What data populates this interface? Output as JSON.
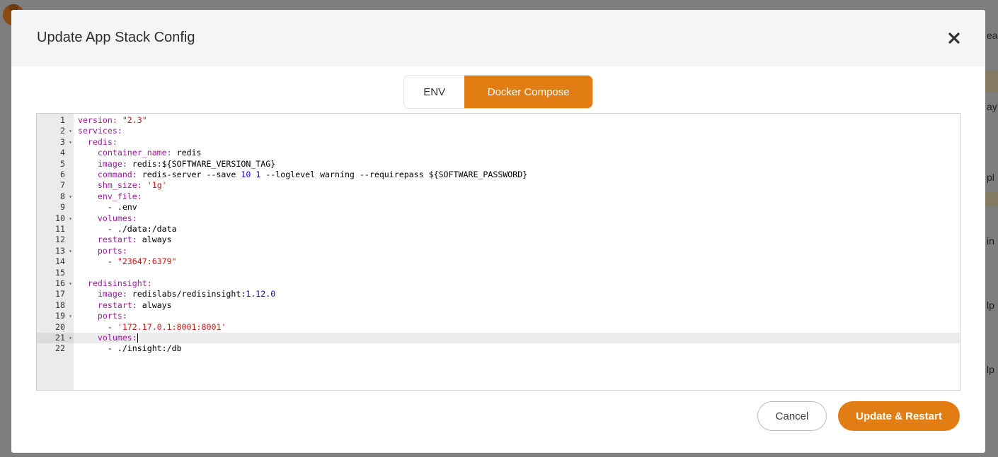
{
  "background": {
    "side_labels": [
      "ead",
      "ay",
      "pl",
      "in",
      "lp",
      "lp"
    ]
  },
  "modal": {
    "title": "Update App Stack Config",
    "close_icon": "close-icon",
    "tabs": [
      {
        "label": "ENV",
        "active": false
      },
      {
        "label": "Docker Compose",
        "active": true
      }
    ],
    "editor": {
      "active_line": 21,
      "lines": [
        {
          "n": "1",
          "fold": false,
          "tokens": [
            {
              "t": "key",
              "v": "version: "
            },
            {
              "t": "str",
              "v": "\"2.3\""
            }
          ]
        },
        {
          "n": "2",
          "fold": true,
          "tokens": [
            {
              "t": "key",
              "v": "services:"
            }
          ]
        },
        {
          "n": "3",
          "fold": true,
          "tokens": [
            {
              "t": "plain",
              "v": "  "
            },
            {
              "t": "key",
              "v": "redis:"
            }
          ]
        },
        {
          "n": "4",
          "fold": false,
          "tokens": [
            {
              "t": "plain",
              "v": "    "
            },
            {
              "t": "key",
              "v": "container_name: "
            },
            {
              "t": "plain",
              "v": "redis"
            }
          ]
        },
        {
          "n": "5",
          "fold": false,
          "tokens": [
            {
              "t": "plain",
              "v": "    "
            },
            {
              "t": "key",
              "v": "image: "
            },
            {
              "t": "plain",
              "v": "redis:${SOFTWARE_VERSION_TAG}"
            }
          ]
        },
        {
          "n": "6",
          "fold": false,
          "tokens": [
            {
              "t": "plain",
              "v": "    "
            },
            {
              "t": "key",
              "v": "command: "
            },
            {
              "t": "plain",
              "v": "redis-server --save "
            },
            {
              "t": "num",
              "v": "10"
            },
            {
              "t": "plain",
              "v": " "
            },
            {
              "t": "num",
              "v": "1"
            },
            {
              "t": "plain",
              "v": " --loglevel warning --requirepass ${SOFTWARE_PASSWORD}"
            }
          ]
        },
        {
          "n": "7",
          "fold": false,
          "tokens": [
            {
              "t": "plain",
              "v": "    "
            },
            {
              "t": "key",
              "v": "shm_size: "
            },
            {
              "t": "str",
              "v": "'1g'"
            }
          ]
        },
        {
          "n": "8",
          "fold": true,
          "tokens": [
            {
              "t": "plain",
              "v": "    "
            },
            {
              "t": "key",
              "v": "env_file:"
            }
          ]
        },
        {
          "n": "9",
          "fold": false,
          "tokens": [
            {
              "t": "plain",
              "v": "      - .env"
            }
          ]
        },
        {
          "n": "10",
          "fold": true,
          "tokens": [
            {
              "t": "plain",
              "v": "    "
            },
            {
              "t": "key",
              "v": "volumes:"
            }
          ]
        },
        {
          "n": "11",
          "fold": false,
          "tokens": [
            {
              "t": "plain",
              "v": "      - ./data:/data"
            }
          ]
        },
        {
          "n": "12",
          "fold": false,
          "tokens": [
            {
              "t": "plain",
              "v": "    "
            },
            {
              "t": "key",
              "v": "restart: "
            },
            {
              "t": "plain",
              "v": "always"
            }
          ]
        },
        {
          "n": "13",
          "fold": true,
          "tokens": [
            {
              "t": "plain",
              "v": "    "
            },
            {
              "t": "key",
              "v": "ports:"
            }
          ]
        },
        {
          "n": "14",
          "fold": false,
          "tokens": [
            {
              "t": "plain",
              "v": "      - "
            },
            {
              "t": "str",
              "v": "\"23647:6379\""
            }
          ]
        },
        {
          "n": "15",
          "fold": false,
          "tokens": []
        },
        {
          "n": "16",
          "fold": true,
          "tokens": [
            {
              "t": "plain",
              "v": "  "
            },
            {
              "t": "key",
              "v": "redisinsight:"
            }
          ]
        },
        {
          "n": "17",
          "fold": false,
          "tokens": [
            {
              "t": "plain",
              "v": "    "
            },
            {
              "t": "key",
              "v": "image: "
            },
            {
              "t": "plain",
              "v": "redislabs/redisinsight:"
            },
            {
              "t": "num",
              "v": "1.12.0"
            }
          ]
        },
        {
          "n": "18",
          "fold": false,
          "tokens": [
            {
              "t": "plain",
              "v": "    "
            },
            {
              "t": "key",
              "v": "restart: "
            },
            {
              "t": "plain",
              "v": "always"
            }
          ]
        },
        {
          "n": "19",
          "fold": true,
          "tokens": [
            {
              "t": "plain",
              "v": "    "
            },
            {
              "t": "key",
              "v": "ports:"
            }
          ]
        },
        {
          "n": "20",
          "fold": false,
          "tokens": [
            {
              "t": "plain",
              "v": "      - "
            },
            {
              "t": "str",
              "v": "'172.17.0.1:8001:8001'"
            }
          ]
        },
        {
          "n": "21",
          "fold": true,
          "tokens": [
            {
              "t": "plain",
              "v": "    "
            },
            {
              "t": "key",
              "v": "volumes:"
            }
          ]
        },
        {
          "n": "22",
          "fold": false,
          "tokens": [
            {
              "t": "plain",
              "v": "      - ./insight:/db"
            }
          ]
        }
      ]
    },
    "buttons": {
      "cancel": "Cancel",
      "update": "Update & Restart"
    }
  },
  "colors": {
    "accent": "#e27d14",
    "yaml_key": "#9a1a9a",
    "yaml_string": "#c41a16",
    "yaml_number": "#1c00cf"
  }
}
